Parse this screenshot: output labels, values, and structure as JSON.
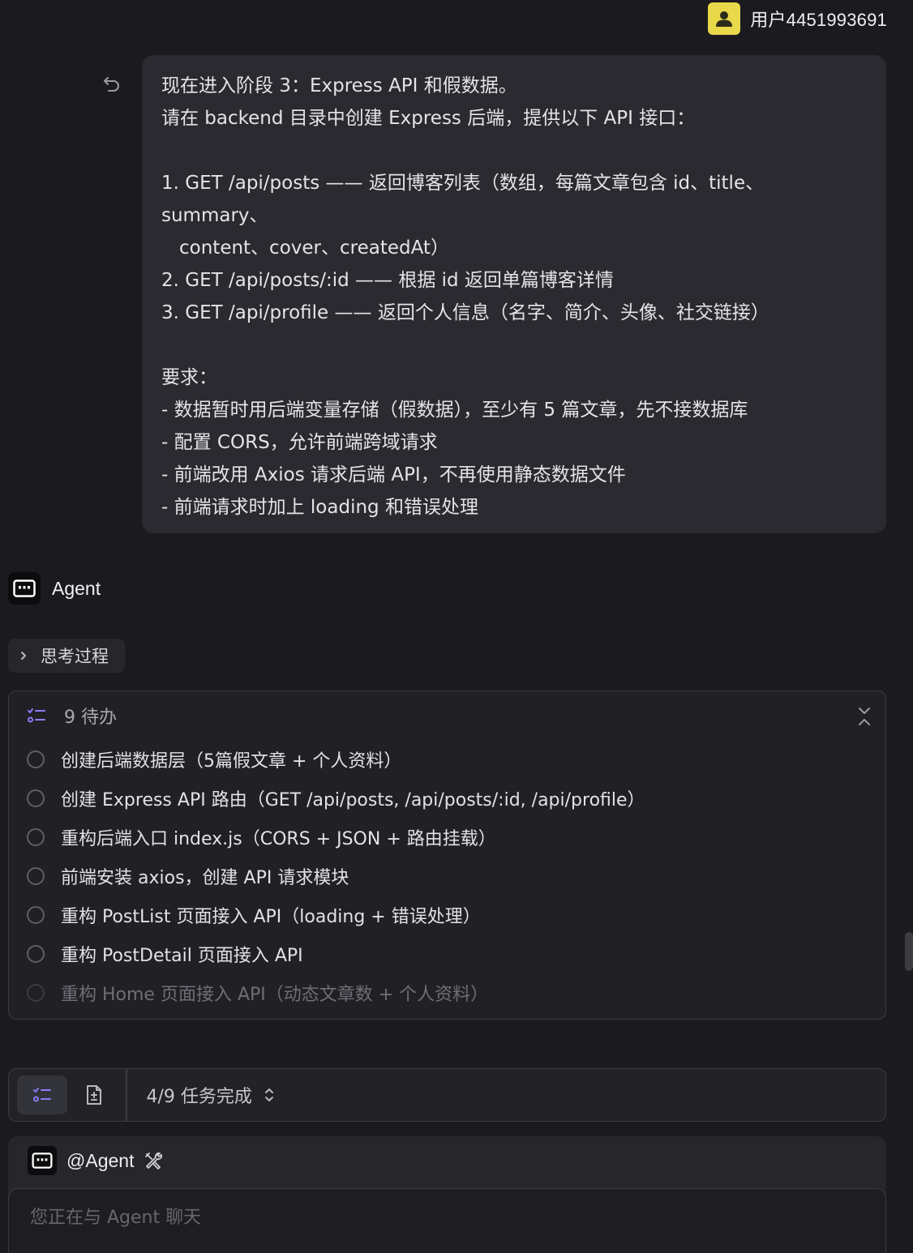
{
  "user": {
    "name": "用户4451993691"
  },
  "message": {
    "lines": [
      "现在进入阶段 3：Express API 和假数据。",
      "请在 backend 目录中创建 Express 后端，提供以下 API 接口：",
      "",
      "1. GET /api/posts —— 返回博客列表（数组，每篇文章包含 id、title、",
      "summary、",
      "content、cover、createdAt）",
      "2. GET /api/posts/:id —— 根据 id 返回单篇博客详情",
      "3. GET /api/profile —— 返回个人信息（名字、简介、头像、社交链接）",
      "",
      "要求：",
      "- 数据暂时用后端变量存储（假数据），至少有 5 篇文章，先不接数据库",
      "- 配置 CORS，允许前端跨域请求",
      "- 前端改用 Axios 请求后端 API，不再使用静态数据文件",
      "- 前端请求时加上 loading 和错误处理"
    ]
  },
  "agent": {
    "label": "Agent",
    "thinking_label": "思考过程"
  },
  "todos": {
    "count_label": "9 待办",
    "items": [
      "创建后端数据层（5篇假文章 + 个人资料）",
      "创建 Express API 路由（GET /api/posts, /api/posts/:id, /api/profile）",
      "重构后端入口 index.js（CORS + JSON + 路由挂载）",
      "前端安装 axios，创建 API 请求模块",
      "重构 PostList 页面接入 API（loading + 错误处理）",
      "重构 PostDetail 页面接入 API",
      "重构 Home 页面接入 API（动态文章数 + 个人资料）"
    ]
  },
  "task_bar": {
    "status": "4/9 任务完成"
  },
  "input": {
    "mention": "@Agent",
    "placeholder": "您正在与 Agent 聊天"
  },
  "colors": {
    "background": "#1b1b1f",
    "bubble": "#2a2a30",
    "avatar": "#e8d84a",
    "accent": "#8b7cf6"
  }
}
